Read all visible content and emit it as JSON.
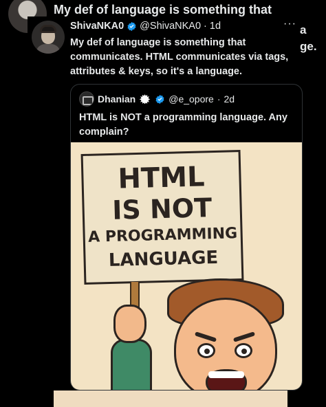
{
  "background_tweet": {
    "title_line": "My def of language is something that",
    "right_fragment_1": "a",
    "right_fragment_2": "ge."
  },
  "tweet": {
    "author_name": "ShivaNKA0",
    "handle": "@ShivaNKA0",
    "separator": "·",
    "time": "1d",
    "more": "···",
    "text": "My def of language is something that communicates. HTML communicates via tags, attributes & keys, so it's a language."
  },
  "quoted_tweet": {
    "author_name": "Dhanian",
    "handle": "@e_opore",
    "separator": "·",
    "time": "2d",
    "text": "HTML is NOT a programming language. Any complain?",
    "image": {
      "sign_line_1": "HTML",
      "sign_line_2": "IS NOT",
      "sign_line_3": "A PROGRAMMING",
      "sign_line_4": "LANGUAGE"
    }
  },
  "colors": {
    "background": "#000000",
    "text": "#e7e9ea",
    "verified_blue": "#1d9bf0",
    "border": "#2f3336"
  }
}
